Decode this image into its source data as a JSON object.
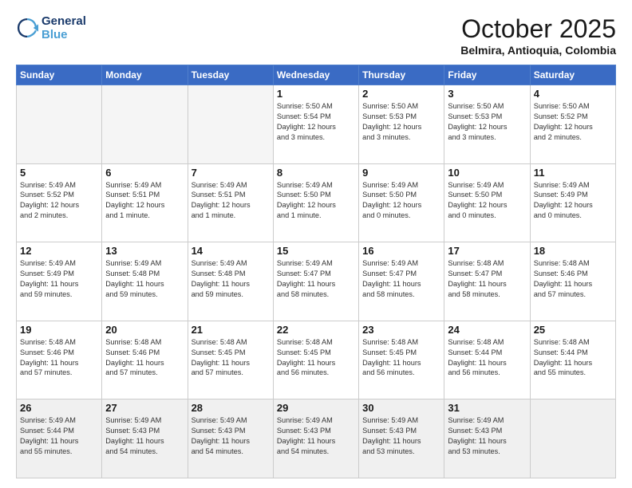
{
  "logo": {
    "line1": "General",
    "line2": "Blue"
  },
  "header": {
    "month": "October 2025",
    "location": "Belmira, Antioquia, Colombia"
  },
  "weekdays": [
    "Sunday",
    "Monday",
    "Tuesday",
    "Wednesday",
    "Thursday",
    "Friday",
    "Saturday"
  ],
  "weeks": [
    [
      {
        "day": "",
        "info": ""
      },
      {
        "day": "",
        "info": ""
      },
      {
        "day": "",
        "info": ""
      },
      {
        "day": "1",
        "info": "Sunrise: 5:50 AM\nSunset: 5:54 PM\nDaylight: 12 hours\nand 3 minutes."
      },
      {
        "day": "2",
        "info": "Sunrise: 5:50 AM\nSunset: 5:53 PM\nDaylight: 12 hours\nand 3 minutes."
      },
      {
        "day": "3",
        "info": "Sunrise: 5:50 AM\nSunset: 5:53 PM\nDaylight: 12 hours\nand 3 minutes."
      },
      {
        "day": "4",
        "info": "Sunrise: 5:50 AM\nSunset: 5:52 PM\nDaylight: 12 hours\nand 2 minutes."
      }
    ],
    [
      {
        "day": "5",
        "info": "Sunrise: 5:49 AM\nSunset: 5:52 PM\nDaylight: 12 hours\nand 2 minutes."
      },
      {
        "day": "6",
        "info": "Sunrise: 5:49 AM\nSunset: 5:51 PM\nDaylight: 12 hours\nand 1 minute."
      },
      {
        "day": "7",
        "info": "Sunrise: 5:49 AM\nSunset: 5:51 PM\nDaylight: 12 hours\nand 1 minute."
      },
      {
        "day": "8",
        "info": "Sunrise: 5:49 AM\nSunset: 5:50 PM\nDaylight: 12 hours\nand 1 minute."
      },
      {
        "day": "9",
        "info": "Sunrise: 5:49 AM\nSunset: 5:50 PM\nDaylight: 12 hours\nand 0 minutes."
      },
      {
        "day": "10",
        "info": "Sunrise: 5:49 AM\nSunset: 5:50 PM\nDaylight: 12 hours\nand 0 minutes."
      },
      {
        "day": "11",
        "info": "Sunrise: 5:49 AM\nSunset: 5:49 PM\nDaylight: 12 hours\nand 0 minutes."
      }
    ],
    [
      {
        "day": "12",
        "info": "Sunrise: 5:49 AM\nSunset: 5:49 PM\nDaylight: 11 hours\nand 59 minutes."
      },
      {
        "day": "13",
        "info": "Sunrise: 5:49 AM\nSunset: 5:48 PM\nDaylight: 11 hours\nand 59 minutes."
      },
      {
        "day": "14",
        "info": "Sunrise: 5:49 AM\nSunset: 5:48 PM\nDaylight: 11 hours\nand 59 minutes."
      },
      {
        "day": "15",
        "info": "Sunrise: 5:49 AM\nSunset: 5:47 PM\nDaylight: 11 hours\nand 58 minutes."
      },
      {
        "day": "16",
        "info": "Sunrise: 5:49 AM\nSunset: 5:47 PM\nDaylight: 11 hours\nand 58 minutes."
      },
      {
        "day": "17",
        "info": "Sunrise: 5:48 AM\nSunset: 5:47 PM\nDaylight: 11 hours\nand 58 minutes."
      },
      {
        "day": "18",
        "info": "Sunrise: 5:48 AM\nSunset: 5:46 PM\nDaylight: 11 hours\nand 57 minutes."
      }
    ],
    [
      {
        "day": "19",
        "info": "Sunrise: 5:48 AM\nSunset: 5:46 PM\nDaylight: 11 hours\nand 57 minutes."
      },
      {
        "day": "20",
        "info": "Sunrise: 5:48 AM\nSunset: 5:46 PM\nDaylight: 11 hours\nand 57 minutes."
      },
      {
        "day": "21",
        "info": "Sunrise: 5:48 AM\nSunset: 5:45 PM\nDaylight: 11 hours\nand 57 minutes."
      },
      {
        "day": "22",
        "info": "Sunrise: 5:48 AM\nSunset: 5:45 PM\nDaylight: 11 hours\nand 56 minutes."
      },
      {
        "day": "23",
        "info": "Sunrise: 5:48 AM\nSunset: 5:45 PM\nDaylight: 11 hours\nand 56 minutes."
      },
      {
        "day": "24",
        "info": "Sunrise: 5:48 AM\nSunset: 5:44 PM\nDaylight: 11 hours\nand 56 minutes."
      },
      {
        "day": "25",
        "info": "Sunrise: 5:48 AM\nSunset: 5:44 PM\nDaylight: 11 hours\nand 55 minutes."
      }
    ],
    [
      {
        "day": "26",
        "info": "Sunrise: 5:49 AM\nSunset: 5:44 PM\nDaylight: 11 hours\nand 55 minutes."
      },
      {
        "day": "27",
        "info": "Sunrise: 5:49 AM\nSunset: 5:43 PM\nDaylight: 11 hours\nand 54 minutes."
      },
      {
        "day": "28",
        "info": "Sunrise: 5:49 AM\nSunset: 5:43 PM\nDaylight: 11 hours\nand 54 minutes."
      },
      {
        "day": "29",
        "info": "Sunrise: 5:49 AM\nSunset: 5:43 PM\nDaylight: 11 hours\nand 54 minutes."
      },
      {
        "day": "30",
        "info": "Sunrise: 5:49 AM\nSunset: 5:43 PM\nDaylight: 11 hours\nand 53 minutes."
      },
      {
        "day": "31",
        "info": "Sunrise: 5:49 AM\nSunset: 5:43 PM\nDaylight: 11 hours\nand 53 minutes."
      },
      {
        "day": "",
        "info": ""
      }
    ]
  ]
}
